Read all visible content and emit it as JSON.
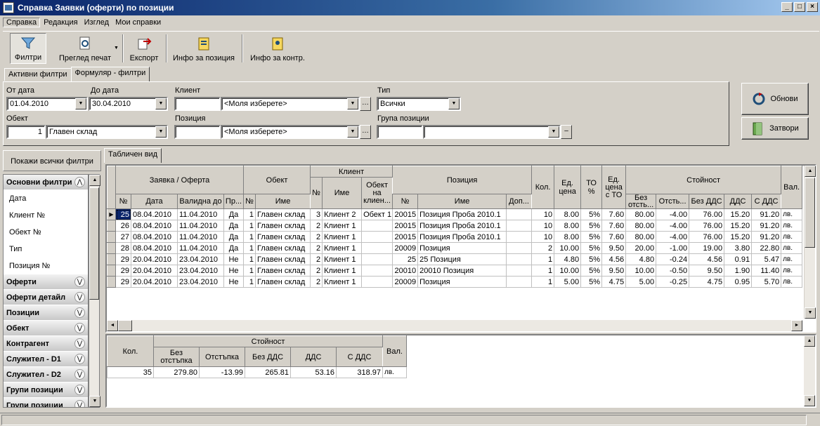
{
  "window": {
    "title": "Справка Заявки (оферти) по позиции"
  },
  "menu": [
    "Справка",
    "Редакция",
    "Изглед",
    "Мои справки"
  ],
  "toolbar": {
    "filters": "Филтри",
    "print_preview": "Преглед печат",
    "export": "Експорт",
    "item_info": "Инфо за позиция",
    "contractor_info": "Инфо за контр."
  },
  "tabs": [
    "Активни филтри",
    "Формуляр - филтри"
  ],
  "form": {
    "from_date_label": "От дата",
    "from_date": "01.04.2010",
    "to_date_label": "До дата",
    "to_date": "30.04.2010",
    "client_label": "Клиент",
    "client_code": "",
    "client_value": "<Моля изберете>",
    "type_label": "Тип",
    "type_value": "Всички",
    "object_label": "Обект",
    "object_code": "1",
    "object_value": "Главен склад",
    "item_label": "Позиция",
    "item_code": "",
    "item_value": "<Моля изберете>",
    "item_group_label": "Група позиции",
    "item_group_code": "",
    "item_group_value": ""
  },
  "buttons": {
    "refresh": "Обнови",
    "close": "Затвори"
  },
  "left": {
    "show_all": "Покажи всички филтри",
    "main_filters": "Основни филтри",
    "main_items": [
      "Дата",
      "Клиент №",
      "Обект №",
      "Тип",
      "Позиция №"
    ],
    "sections": [
      "Оферти",
      "Оферти детайл",
      "Позиции",
      "Обект",
      "Контрагент",
      "Служител - D1",
      "Служител - D2",
      "Групи позиции",
      "Групи позиции"
    ]
  },
  "grid_tab": "Табличен вид",
  "grid": {
    "group_headers": {
      "order": "Заявка / Оферта",
      "object": "Обект",
      "client": "Клиент",
      "item": "Позиция",
      "qty": "Кол.",
      "unit_price": "Ед. цена",
      "to_pct": "ТО %",
      "unit_price_to": "Ед. цена с ТО",
      "value": "Стойност",
      "currency": "Вал."
    },
    "sub_headers": [
      "№",
      "Дата",
      "Валидна до",
      "Пр...",
      "№",
      "Име",
      "№",
      "Име",
      "Обект на клиен...",
      "№",
      "Име",
      "Доп...",
      "Без отсть...",
      "Отсть...",
      "Без ДДС",
      "ДДС",
      "С ДДС"
    ],
    "rows": [
      [
        "25",
        "08.04.2010",
        "11.04.2010",
        "Да",
        "1",
        "Главен склад",
        "3",
        "Клиент 2",
        "Обект 1",
        "20015",
        "Позиция Проба 2010.1",
        "",
        "10",
        "8.00",
        "5%",
        "7.60",
        "80.00",
        "-4.00",
        "76.00",
        "15.20",
        "91.20",
        "лв."
      ],
      [
        "26",
        "08.04.2010",
        "11.04.2010",
        "Да",
        "1",
        "Главен склад",
        "2",
        "Клиент 1",
        "",
        "20015",
        "Позиция Проба 2010.1",
        "",
        "10",
        "8.00",
        "5%",
        "7.60",
        "80.00",
        "-4.00",
        "76.00",
        "15.20",
        "91.20",
        "лв."
      ],
      [
        "27",
        "08.04.2010",
        "11.04.2010",
        "Да",
        "1",
        "Главен склад",
        "2",
        "Клиент 1",
        "",
        "20015",
        "Позиция Проба 2010.1",
        "",
        "10",
        "8.00",
        "5%",
        "7.60",
        "80.00",
        "-4.00",
        "76.00",
        "15.20",
        "91.20",
        "лв."
      ],
      [
        "28",
        "08.04.2010",
        "11.04.2010",
        "Да",
        "1",
        "Главен склад",
        "2",
        "Клиент 1",
        "",
        "20009",
        "Позиция",
        "",
        "2",
        "10.00",
        "5%",
        "9.50",
        "20.00",
        "-1.00",
        "19.00",
        "3.80",
        "22.80",
        "лв."
      ],
      [
        "29",
        "20.04.2010",
        "23.04.2010",
        "Не",
        "1",
        "Главен склад",
        "2",
        "Клиент 1",
        "",
        "25",
        "25 Позиция",
        "",
        "1",
        "4.80",
        "5%",
        "4.56",
        "4.80",
        "-0.24",
        "4.56",
        "0.91",
        "5.47",
        "лв."
      ],
      [
        "29",
        "20.04.2010",
        "23.04.2010",
        "Не",
        "1",
        "Главен склад",
        "2",
        "Клиент 1",
        "",
        "20010",
        "20010 Позиция",
        "",
        "1",
        "10.00",
        "5%",
        "9.50",
        "10.00",
        "-0.50",
        "9.50",
        "1.90",
        "11.40",
        "лв."
      ],
      [
        "29",
        "20.04.2010",
        "23.04.2010",
        "Не",
        "1",
        "Главен склад",
        "2",
        "Клиент 1",
        "",
        "20009",
        "Позиция",
        "",
        "1",
        "5.00",
        "5%",
        "4.75",
        "5.00",
        "-0.25",
        "4.75",
        "0.95",
        "5.70",
        "лв."
      ]
    ]
  },
  "summary": {
    "qty_header": "Кол.",
    "value_header": "Стойност",
    "sub_headers": [
      "Без отстъпка",
      "Отстъпка",
      "Без ДДС",
      "ДДС",
      "С ДДС"
    ],
    "currency_header": "Вал.",
    "row": [
      "35",
      "279.80",
      "-13.99",
      "265.81",
      "53.16",
      "318.97",
      "лв."
    ]
  }
}
